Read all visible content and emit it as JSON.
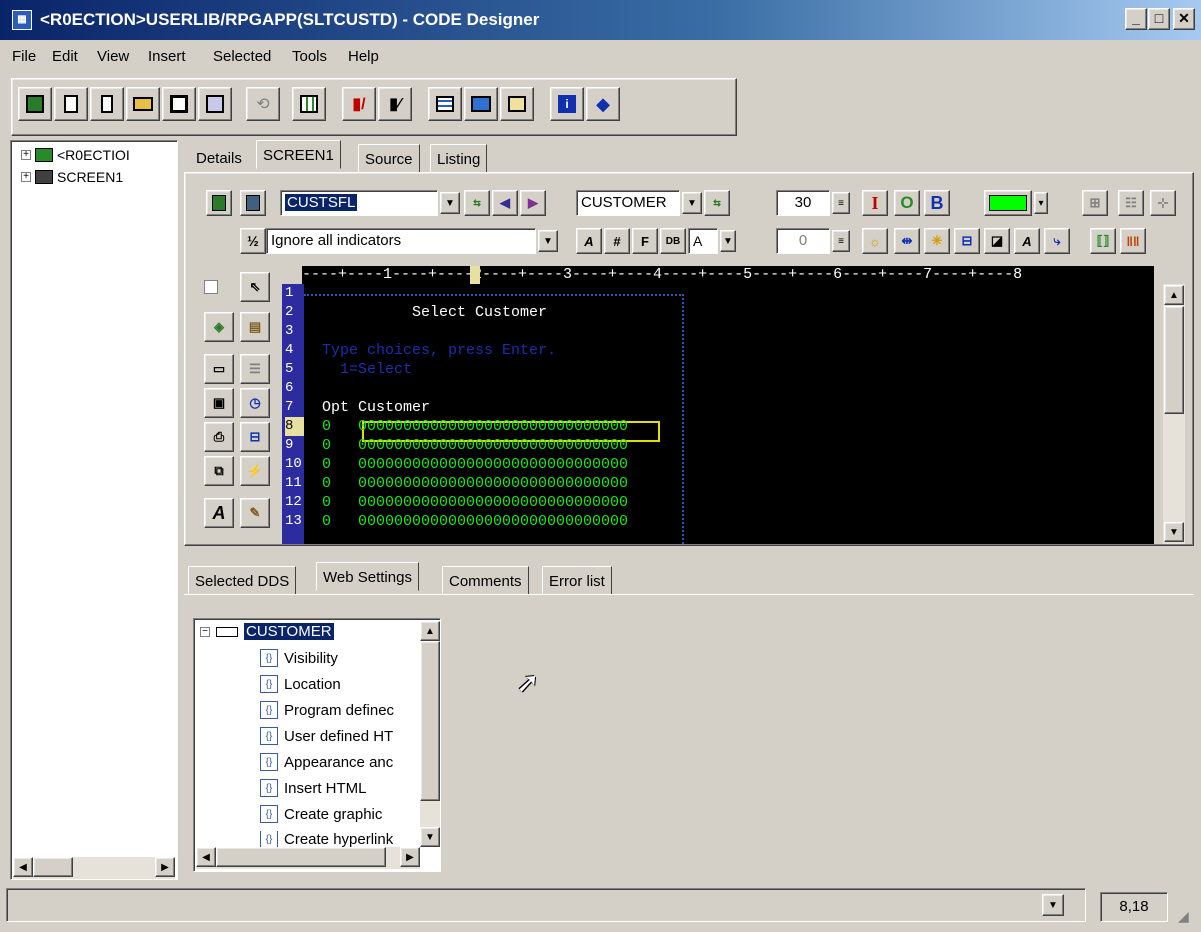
{
  "window": {
    "title": "<R0ECTION>USERLIB/RPGAPP(SLTCUSTD) - CODE Designer"
  },
  "menu": [
    "File",
    "Edit",
    "View",
    "Insert",
    "Selected",
    "Tools",
    "Help"
  ],
  "toolbar_icons": [
    "new-project-icon",
    "new-file-icon",
    "new-document-icon",
    "open-folder-icon",
    "save-icon",
    "save-all-icon",
    "disabled-action-icon",
    "grid-icon",
    "check-edit-icon",
    "edit-doc-icon",
    "list-icon",
    "key-icon",
    "panel-icon",
    "info-icon",
    "diamond-icon"
  ],
  "left_tree": {
    "items": [
      "<R0ECTIOI",
      "SCREEN1"
    ]
  },
  "top_tabs": [
    "Details",
    "SCREEN1",
    "Source",
    "Listing"
  ],
  "active_top_tab": "SCREEN1",
  "editor": {
    "record_combo": "CUSTSFL",
    "file_combo": "CUSTOMER",
    "size_value": "30",
    "indicator_combo": "Ignore all indicators",
    "attr_combo": "A",
    "small_value": "0",
    "style_buttons": [
      "I",
      "O",
      "B"
    ],
    "color_swatch": "#00ff00"
  },
  "ruler": "----+----1----+----2----+----3----+----4----+----5----+----6----+----7----+----8",
  "screen_lines": [
    {
      "n": "1",
      "text": ""
    },
    {
      "n": "2",
      "text": "          Select Customer",
      "color": "#ffffff"
    },
    {
      "n": "3",
      "text": ""
    },
    {
      "n": "4",
      "text": "Type choices, press Enter.",
      "color": "#1a2fa8"
    },
    {
      "n": "5",
      "text": "  1=Select",
      "color": "#1a2fa8"
    },
    {
      "n": "6",
      "text": ""
    },
    {
      "n": "7",
      "text": "Opt Customer",
      "color": "#ffffff"
    },
    {
      "n": "8",
      "text": "0   000000000000000000000000000000",
      "color": "#22e022"
    },
    {
      "n": "9",
      "text": "0   000000000000000000000000000000",
      "color": "#22e022"
    },
    {
      "n": "10",
      "text": "0   000000000000000000000000000000",
      "color": "#22e022"
    },
    {
      "n": "11",
      "text": "0   000000000000000000000000000000",
      "color": "#22e022"
    },
    {
      "n": "12",
      "text": "0   000000000000000000000000000000",
      "color": "#22e022"
    },
    {
      "n": "13",
      "text": "0   000000000000000000000000000000",
      "color": "#22e022"
    }
  ],
  "bottom_tabs": [
    "Selected DDS",
    "Web Settings",
    "Comments",
    "Error list"
  ],
  "active_bottom_tab": "Web Settings",
  "dds_tree": {
    "root": "CUSTOMER",
    "items": [
      "Visibility",
      "Location",
      "Program definec",
      "User defined HT",
      "Appearance anc",
      "Insert HTML",
      "Create graphic",
      "Create hyperlink"
    ]
  },
  "status": {
    "position": "8,18"
  }
}
